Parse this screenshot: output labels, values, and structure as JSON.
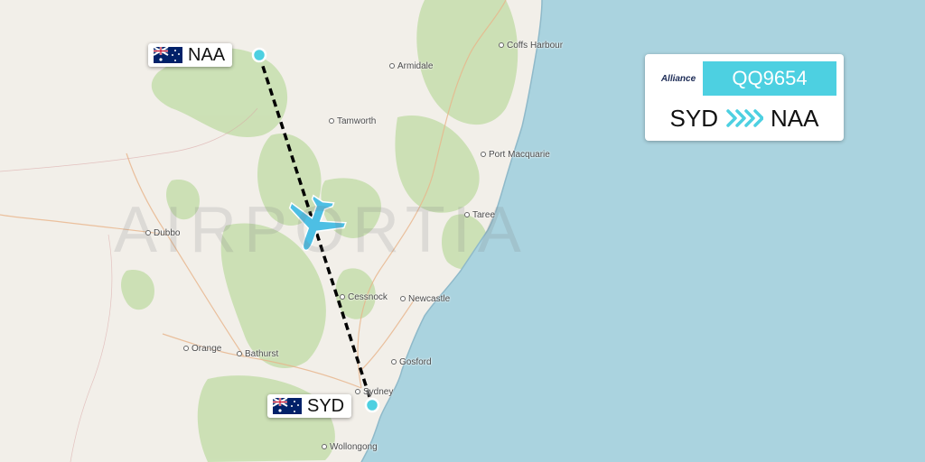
{
  "watermark": "AIRPORTIA",
  "places": [
    {
      "name": "Coffs Harbour"
    },
    {
      "name": "Armidale"
    },
    {
      "name": "Tamworth"
    },
    {
      "name": "Port Macquarie"
    },
    {
      "name": "Taree"
    },
    {
      "name": "Dubbo"
    },
    {
      "name": "Cessnock"
    },
    {
      "name": "Newcastle"
    },
    {
      "name": "Orange"
    },
    {
      "name": "Bathurst"
    },
    {
      "name": "Gosford"
    },
    {
      "name": "Sydney"
    },
    {
      "name": "Wollongong"
    }
  ],
  "origin": {
    "code": "SYD",
    "flag": "australia-flag"
  },
  "destination": {
    "code": "NAA",
    "flag": "australia-flag"
  },
  "card": {
    "airline_logo": "Alliance",
    "flight_number": "QQ9654",
    "from": "SYD",
    "to": "NAA",
    "accent": "#4dd0e1"
  },
  "colors": {
    "sea": "#aad3df",
    "land": "#f2efe9",
    "forest": "#c8dfb0",
    "route": "#000000",
    "airport": "#4dd0e1"
  }
}
